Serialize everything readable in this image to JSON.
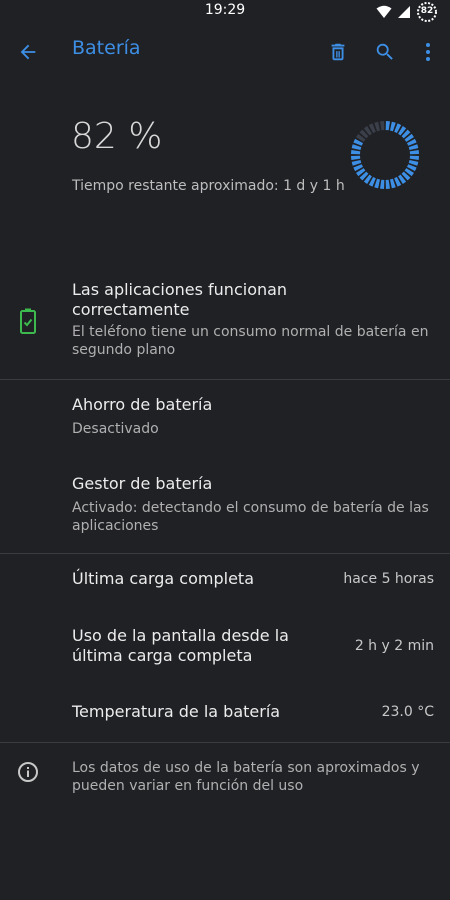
{
  "status_bar": {
    "time": "19:29",
    "battery_level": "82",
    "icons": [
      "wifi-icon",
      "signal-icon",
      "battery-circle-icon"
    ]
  },
  "app_bar": {
    "title": "Batería",
    "icons": [
      "back-arrow-icon",
      "delete-icon",
      "search-icon",
      "more-vert-icon"
    ]
  },
  "battery": {
    "percent": "82 %",
    "remaining": "Tiempo restante aproximado: 1 d y 1 h",
    "level_fraction": 0.82
  },
  "apps_status": {
    "title": "Las aplicaciones funcionan correctamente",
    "subtitle": "El teléfono tiene un consumo normal de batería en segundo plano"
  },
  "saver": {
    "title": "Ahorro de batería",
    "subtitle": "Desactivado"
  },
  "manager": {
    "title": "Gestor de batería",
    "subtitle": "Activado: detectando el consumo de batería de las aplicaciones"
  },
  "last_charge": {
    "title": "Última carga completa",
    "value": "hace 5 horas"
  },
  "screen_usage": {
    "title": "Uso de la pantalla desde la última carga completa",
    "value": "2 h y 2 min"
  },
  "temperature": {
    "title": "Temperatura de la batería",
    "value": "23.0 °C"
  },
  "footer": {
    "text": "Los datos de uso de la batería son aproximados y pueden variar en función del uso"
  },
  "colors": {
    "background": "#202125",
    "accent": "#3d8fe5",
    "ring_track": "#3a3f4a",
    "battery_ok": "#3dba4e"
  }
}
